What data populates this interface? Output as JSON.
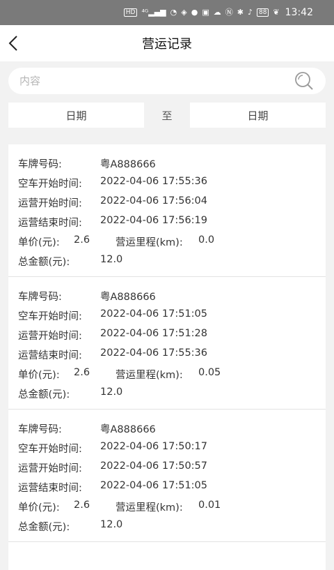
{
  "status_bar": {
    "time": "13:42",
    "battery": "88",
    "icons": [
      "hd-icon",
      "4g-signal-icon",
      "wifi-icon",
      "app-notification-icon",
      "qq-icon",
      "mail-icon",
      "cloud-icon",
      "nfc-icon",
      "bluetooth-icon",
      "mute-icon",
      "battery-icon",
      "leaf-icon"
    ]
  },
  "header": {
    "title": "营运记录"
  },
  "search": {
    "placeholder": "内容"
  },
  "date_range": {
    "start": "日期",
    "separator": "至",
    "end": "日期"
  },
  "labels": {
    "plate": "车牌号码:",
    "idle_start": "空车开始时间:",
    "op_start": "运营开始时间:",
    "op_end": "运营结束时间:",
    "unit_price": "单价(元):",
    "mileage": "营运里程(km):",
    "total": "总金额(元):"
  },
  "records": [
    {
      "plate": "粤A888666",
      "idle_start": "2022-04-06 17:55:36",
      "op_start": "2022-04-06 17:56:04",
      "op_end": "2022-04-06 17:56:19",
      "unit_price": "2.6",
      "mileage": "0.0",
      "total": "12.0"
    },
    {
      "plate": "粤A888666",
      "idle_start": "2022-04-06 17:51:05",
      "op_start": "2022-04-06 17:51:28",
      "op_end": "2022-04-06 17:55:36",
      "unit_price": "2.6",
      "mileage": "0.05",
      "total": "12.0"
    },
    {
      "plate": "粤A888666",
      "idle_start": "2022-04-06 17:50:17",
      "op_start": "2022-04-06 17:50:57",
      "op_end": "2022-04-06 17:51:05",
      "unit_price": "2.6",
      "mileage": "0.01",
      "total": "12.0"
    }
  ]
}
